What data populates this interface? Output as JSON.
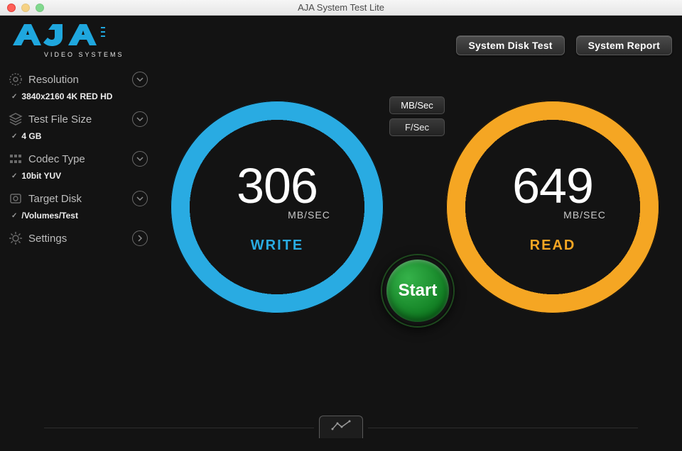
{
  "window": {
    "title": "AJA System Test Lite"
  },
  "logo": {
    "brand": "AJA",
    "tagline": "VIDEO SYSTEMS"
  },
  "header": {
    "disk_test_label": "System Disk Test",
    "report_label": "System Report"
  },
  "sidebar": {
    "resolution": {
      "label": "Resolution",
      "value": "3840x2160 4K RED HD"
    },
    "file_size": {
      "label": "Test File Size",
      "value": "4 GB"
    },
    "codec": {
      "label": "Codec Type",
      "value": "10bit YUV"
    },
    "disk": {
      "label": "Target Disk",
      "value": "/Volumes/Test"
    },
    "settings": {
      "label": "Settings"
    }
  },
  "units": {
    "mb_label": "MB/Sec",
    "f_label": "F/Sec",
    "selected": "MB/Sec"
  },
  "gauges": {
    "write": {
      "value": "306",
      "unit": "MB/SEC",
      "label": "WRITE"
    },
    "read": {
      "value": "649",
      "unit": "MB/SEC",
      "label": "READ"
    }
  },
  "start_label": "Start",
  "colors": {
    "write": "#29abe2",
    "read": "#f5a623",
    "start": "#1a9a2f"
  }
}
